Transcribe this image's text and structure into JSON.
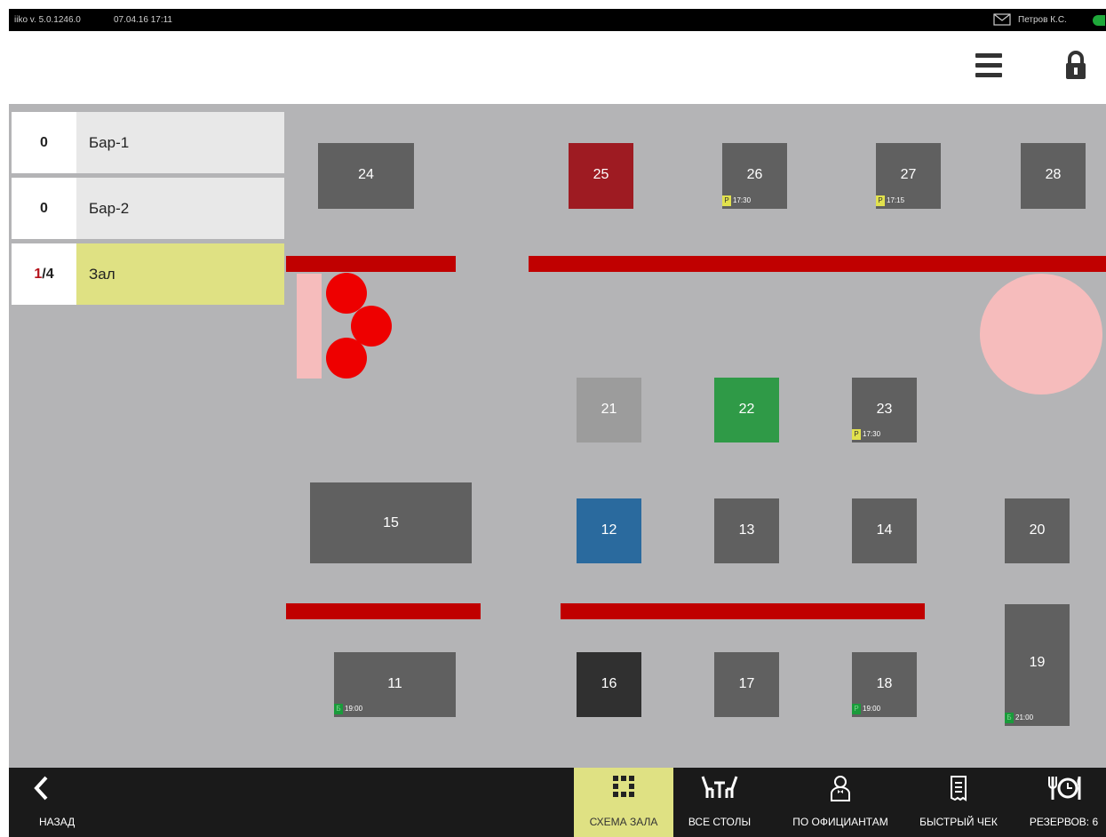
{
  "status": {
    "version": "iiko v. 5.0.1246.0",
    "datetime": "07.04.16  17:11",
    "user": "Петров К.С."
  },
  "sections": [
    {
      "busy": "",
      "count": "0",
      "name": "Бар-1"
    },
    {
      "busy": "",
      "count": "0",
      "name": "Бар-2"
    },
    {
      "busy": "1",
      "count": "/4",
      "name": "Зал"
    }
  ],
  "tables": [
    {
      "num": "24",
      "state": "free"
    },
    {
      "num": "25",
      "state": "busy-red"
    },
    {
      "num": "26",
      "state": "free",
      "res_tag": "Р",
      "res_time": "17:30"
    },
    {
      "num": "27",
      "state": "free",
      "res_tag": "Р",
      "res_time": "17:15"
    },
    {
      "num": "28",
      "state": "free"
    },
    {
      "num": "21",
      "state": "disabled"
    },
    {
      "num": "22",
      "state": "busy-green"
    },
    {
      "num": "23",
      "state": "free",
      "res_tag": "Р",
      "res_time": "17:30"
    },
    {
      "num": "15",
      "state": "free"
    },
    {
      "num": "12",
      "state": "busy-blue"
    },
    {
      "num": "13",
      "state": "free"
    },
    {
      "num": "14",
      "state": "free"
    },
    {
      "num": "20",
      "state": "free"
    },
    {
      "num": "11",
      "state": "free",
      "res_tag": "Б",
      "res_time": "19:00"
    },
    {
      "num": "16",
      "state": "dark"
    },
    {
      "num": "17",
      "state": "free"
    },
    {
      "num": "18",
      "state": "free",
      "res_tag": "Р",
      "res_time": "19:00"
    },
    {
      "num": "19",
      "state": "free",
      "res_tag": "Б",
      "res_time": "21:00"
    }
  ],
  "colors": {
    "free": "#606060",
    "busy-red": "#9e1b22",
    "busy-green": "#2f9a47",
    "busy-blue": "#2a6a9e",
    "disabled": "#9c9c9c",
    "dark": "#303030",
    "wall": "#c00000",
    "active": "#dfe183"
  },
  "nav": {
    "back": "НАЗАД",
    "scheme": "СХЕМА ЗАЛА",
    "all_tables": "ВСЕ СТОЛЫ",
    "by_waiters": "ПО ОФИЦИАНТАМ",
    "fast_check": "БЫСТРЫЙ ЧЕК",
    "reserves": "РЕЗЕРВОВ: 6"
  },
  "icons": [
    "mail-icon",
    "menu-icon",
    "lock-icon",
    "back-icon",
    "grid-icon",
    "tables-icon",
    "waiter-icon",
    "receipt-icon",
    "reserve-icon"
  ]
}
